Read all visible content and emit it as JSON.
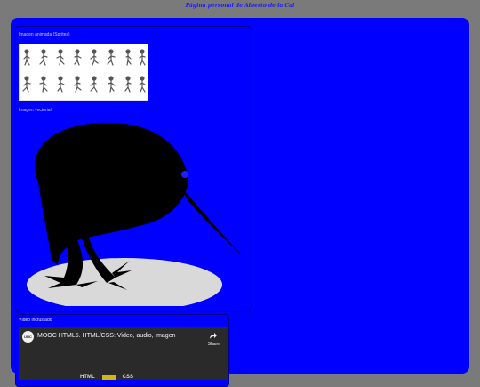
{
  "header": {
    "title": "Página personal de Alberto de la Cal"
  },
  "sections": {
    "sprite_label": "Imagen animada (Sprites)",
    "vector_label": "Imagen vectorial",
    "video_label": "Vídeo incrustado"
  },
  "video": {
    "channel": "UNC",
    "title": "MOOC HTML5. HTML/CSS: Video, audio, imagen",
    "share_label": "Share",
    "badges": [
      "HTML",
      "CSS"
    ]
  },
  "colors": {
    "page_bg": "#7a7a7a",
    "panel_bg": "#0000ff",
    "kiwi": "#000000",
    "shadow": "#d9d9d9"
  }
}
